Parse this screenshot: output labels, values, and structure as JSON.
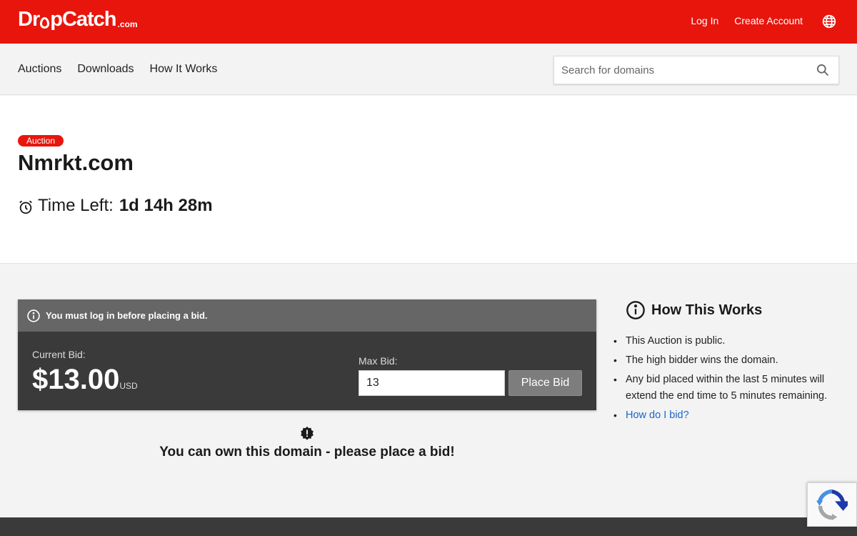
{
  "brand": {
    "name_part1": "Dr",
    "name_part2": "pCatch",
    "suffix": ".com"
  },
  "header": {
    "login": "Log In",
    "create_account": "Create Account"
  },
  "nav": {
    "items": [
      "Auctions",
      "Downloads",
      "How It Works"
    ]
  },
  "search": {
    "placeholder": "Search for domains",
    "value": ""
  },
  "auction": {
    "badge": "Auction",
    "domain": "Nmrkt.com",
    "time_label": "Time Left:",
    "time_value": "1d 14h 28m"
  },
  "bid": {
    "notice": "You must log in before placing a bid.",
    "current_label": "Current Bid:",
    "current_amount": "$13.00",
    "currency": "USD",
    "max_label": "Max Bid:",
    "max_value": "13",
    "place_button": "Place Bid"
  },
  "own_message": "You can own this domain - please place a bid!",
  "how_it_works": {
    "title": "How This Works",
    "items": [
      "This Auction is public.",
      "The high bidder wins the domain.",
      "Any bid placed within the last 5 minutes will extend the end time to 5 minutes remaining."
    ],
    "link": "How do I bid?"
  },
  "colors": {
    "brand_red": "#e8150d",
    "panel_dark": "#3a3a3a",
    "link_blue": "#1a66c9"
  }
}
